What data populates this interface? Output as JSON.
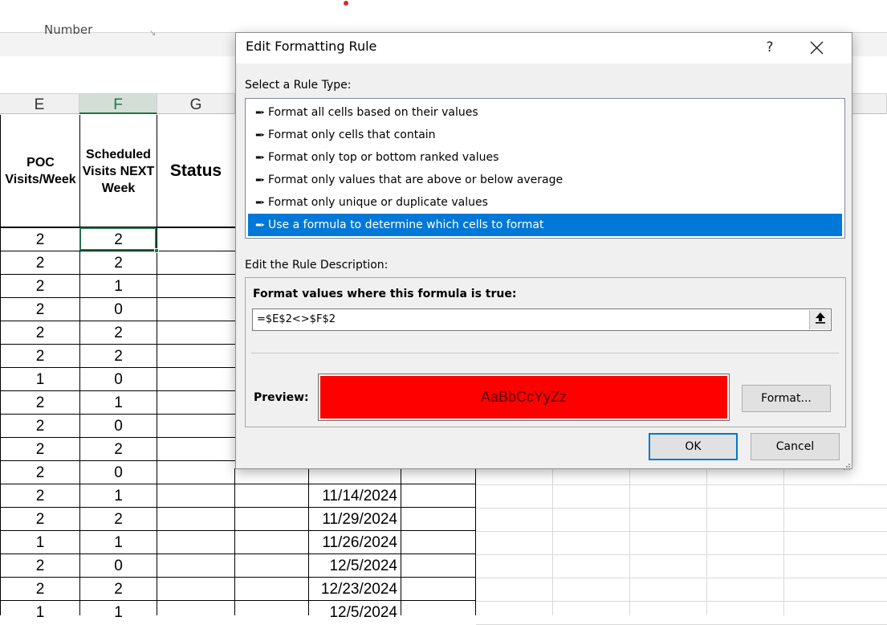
{
  "excel": {
    "ribbon_label": "Number",
    "columns": [
      "E",
      "F",
      "G"
    ],
    "selected_column": "F",
    "headers": {
      "poc": "POC Visits/Week",
      "scheduled": "Scheduled Visits NEXT Week",
      "status": "Status"
    },
    "rows": [
      {
        "e": "2",
        "f": "2",
        "date": ""
      },
      {
        "e": "2",
        "f": "2",
        "date": ""
      },
      {
        "e": "2",
        "f": "1",
        "date": ""
      },
      {
        "e": "2",
        "f": "0",
        "date": ""
      },
      {
        "e": "2",
        "f": "2",
        "date": ""
      },
      {
        "e": "2",
        "f": "2",
        "date": ""
      },
      {
        "e": "1",
        "f": "0",
        "date": ""
      },
      {
        "e": "2",
        "f": "1",
        "date": ""
      },
      {
        "e": "2",
        "f": "0",
        "date": ""
      },
      {
        "e": "2",
        "f": "2",
        "date": ""
      },
      {
        "e": "2",
        "f": "0",
        "date": ""
      },
      {
        "e": "2",
        "f": "1",
        "date": "11/14/2024"
      },
      {
        "e": "2",
        "f": "2",
        "date": "11/29/2024"
      },
      {
        "e": "1",
        "f": "1",
        "date": "11/26/2024"
      },
      {
        "e": "2",
        "f": "0",
        "date": "12/5/2024"
      },
      {
        "e": "2",
        "f": "2",
        "date": "12/23/2024"
      },
      {
        "e": "1",
        "f": "1",
        "date": "12/5/2024"
      }
    ]
  },
  "dialog": {
    "title": "Edit Formatting Rule",
    "help_label": "?",
    "select_rule_type_label": "Select a Rule Type:",
    "rule_types": [
      "Format all cells based on their values",
      "Format only cells that contain",
      "Format only top or bottom ranked values",
      "Format only values that are above or below average",
      "Format only unique or duplicate values",
      "Use a formula to determine which cells to format"
    ],
    "selected_rule_index": 5,
    "edit_description_label": "Edit the Rule Description:",
    "formula_label": "Format values where this formula is true:",
    "formula_value": "=$E$2<>$F$2",
    "preview_label": "Preview:",
    "preview_text": "AaBbCcYyZz",
    "preview_fill_color": "#ff0000",
    "format_button": "Format...",
    "ok_button": "OK",
    "cancel_button": "Cancel",
    "accent_color": "#0078d7"
  }
}
